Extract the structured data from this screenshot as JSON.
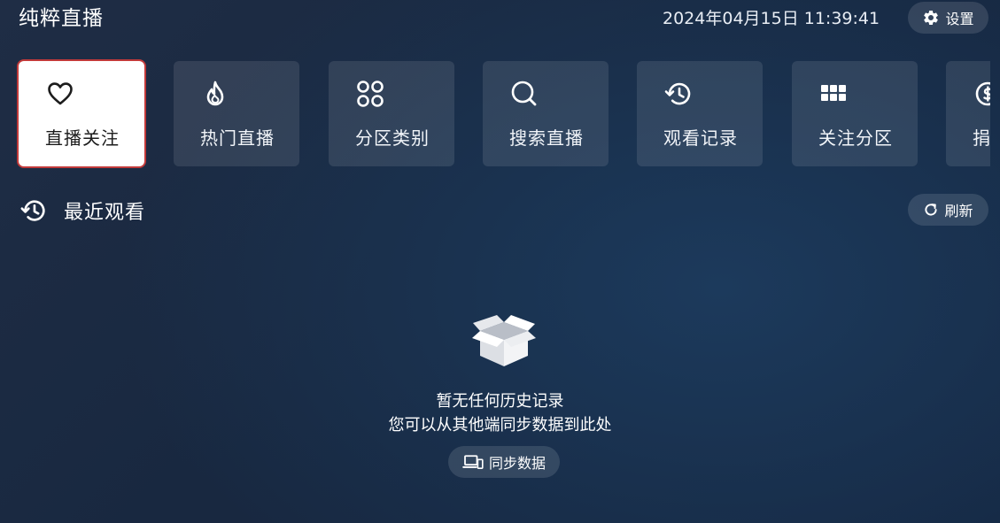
{
  "header": {
    "app_title": "纯粹直播",
    "datetime": "2024年04月15日 11:39:41",
    "settings_label": "设置"
  },
  "nav_tiles": [
    {
      "label": "直播关注",
      "icon": "heart-icon",
      "active": true
    },
    {
      "label": "热门直播",
      "icon": "flame-icon",
      "active": false
    },
    {
      "label": "分区类别",
      "icon": "category-grid-icon",
      "active": false
    },
    {
      "label": "搜索直播",
      "icon": "search-icon",
      "active": false
    },
    {
      "label": "观看记录",
      "icon": "history-icon",
      "active": false
    },
    {
      "label": "关注分区",
      "icon": "apps-grid-icon",
      "active": false
    },
    {
      "label": "捐",
      "icon": "donate-icon",
      "active": false
    }
  ],
  "recent": {
    "title": "最近观看",
    "icon": "history-icon",
    "refresh_label": "刷新"
  },
  "empty_state": {
    "icon": "open-box-icon",
    "line1": "暂无任何历史记录",
    "line2": "您可以从其他端同步数据到此处",
    "sync_label": "同步数据",
    "sync_icon": "devices-icon"
  },
  "colors": {
    "active_tile_border": "#c23a3a",
    "background": "#1a2b44"
  }
}
